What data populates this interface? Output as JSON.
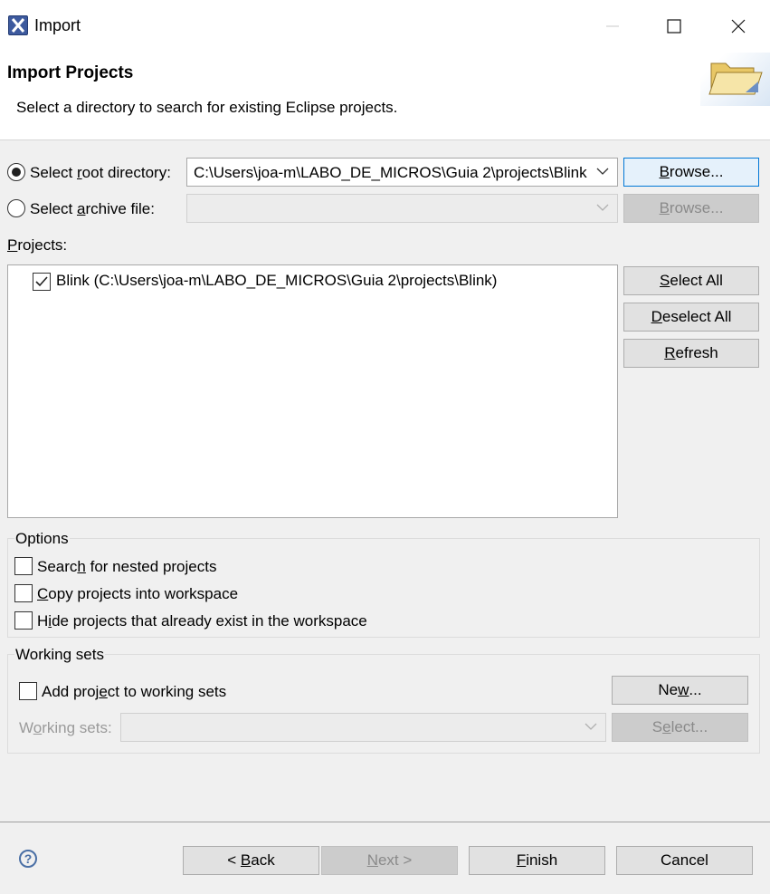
{
  "window": {
    "title": "Import",
    "icon": "eclipse-x-icon",
    "controls": {
      "minimize": "—",
      "maximize": "☐",
      "close": "✕"
    }
  },
  "banner": {
    "title": "Import Projects",
    "description": "Select a directory to search for existing Eclipse projects.",
    "graphic": "folder-icon"
  },
  "source": {
    "root_label_pre": "Select ",
    "root_label_acc": "r",
    "root_label_post": "oot directory:",
    "root_selected": true,
    "root_value": "C:\\Users\\joa-m\\LABO_DE_MICROS\\Guia 2\\projects\\Blink",
    "root_browse_acc": "B",
    "root_browse_post": "rowse...",
    "archive_label_pre": "Select ",
    "archive_label_acc": "a",
    "archive_label_post": "rchive file:",
    "archive_value": "",
    "archive_browse_acc": "B",
    "archive_browse_post": "rowse..."
  },
  "projects": {
    "label_acc": "P",
    "label_post": "rojects:",
    "items": [
      {
        "label": "Blink (C:\\Users\\joa-m\\LABO_DE_MICROS\\Guia 2\\projects\\Blink)",
        "checked": true
      }
    ],
    "select_all_acc": "S",
    "select_all_post": "elect All",
    "deselect_all_acc": "D",
    "deselect_all_post": "eselect All",
    "refresh_pre": "",
    "refresh_acc": "R",
    "refresh_post": "efresh"
  },
  "options": {
    "label": "Options",
    "nested_pre": "Searc",
    "nested_acc": "h",
    "nested_post": " for nested projects",
    "copy_pre": "",
    "copy_acc": "C",
    "copy_post": "opy projects into workspace",
    "hide_pre": "H",
    "hide_acc": "i",
    "hide_post": "de projects that already exist in the workspace"
  },
  "working_sets": {
    "label": "Working sets",
    "add_pre": "Add proj",
    "add_acc": "e",
    "add_post": "ct to working sets",
    "new_pre": "Ne",
    "new_acc": "w",
    "new_post": "...",
    "sets_pre": "W",
    "sets_acc": "o",
    "sets_post": "rking sets:",
    "select_pre": "S",
    "select_acc": "e",
    "select_post": "lect..."
  },
  "footer": {
    "help": "?",
    "back_pre": "< ",
    "back_acc": "B",
    "back_post": "ack",
    "next_acc": "N",
    "next_post": "ext >",
    "finish_acc": "F",
    "finish_post": "inish",
    "cancel": "Cancel"
  }
}
